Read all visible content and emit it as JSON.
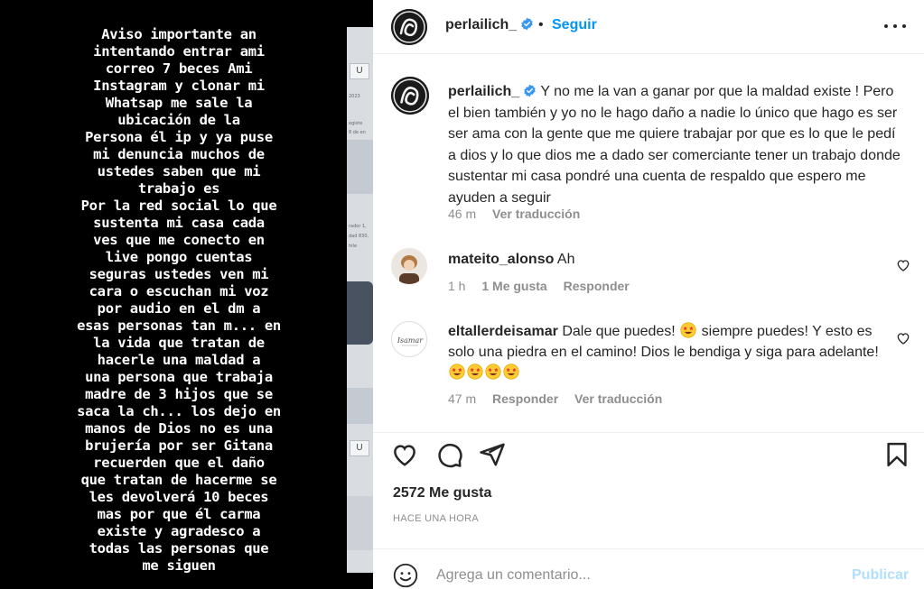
{
  "story": {
    "lines": [
      "Aviso importante  an",
      "intentando entrar ami",
      "correo 7 beces Ami",
      "Instagram  y clonar mi",
      "Whatsap me sale la",
      "ubicación de la",
      "Persona él ip  y ya puse",
      "mi denuncia muchos de",
      "ustedes saben que mi",
      "trabajo  es",
      "Por la red social lo que",
      "sustenta mi casa  cada",
      "ves que me conecto en",
      "live pongo  cuentas",
      "seguras ustedes ven mi",
      "cara o escuchan mi voz",
      "por audio  en el dm  a",
      "esas personas tan m... en",
      "la vida que tratan de",
      "hacerle una maldad a",
      "una persona que trabaja",
      "madre de 3 hijos que se",
      "saca la ch... los dejo en",
      "manos de Dios no es una",
      "brujería por ser Gitana",
      "recuerden que el daño",
      "que tratan de hacerme se",
      "les devolverá 10 beces",
      "mas  por que él carma",
      "existe  y agradesco a",
      "todas las personas que",
      "me siguen"
    ],
    "background_strip": {
      "tag_top": "U",
      "tag_bottom": "U",
      "tiny_lines": [
        "2023",
        "egiste",
        "8 de en",
        "rador 1,",
        "dad 830,",
        "hile"
      ]
    }
  },
  "header": {
    "username": "perlailich_",
    "separator": "•",
    "follow_label": "Seguir",
    "verified_icon": "verified-badge-icon",
    "more_icon": "more-options-icon"
  },
  "caption": {
    "username": "perlailich_",
    "text": "Y no me la van a ganar por que la maldad existe ! Pero el bien también y yo no le hago daño a nadie lo único que hago es ser ser ama con la gente que me quiere trabajar por que es lo que le pedí a dios y lo que dios me a dado ser comerciante tener un trabajo donde sustentar mi casa pondré una cuenta de respaldo que espero me ayuden a seguir",
    "time": "46 m",
    "translate_label": "Ver traducción"
  },
  "comments": [
    {
      "username": "mateito_alonso",
      "text": "Ah",
      "time": "1 h",
      "likes_label": "1 Me gusta",
      "reply_label": "Responder"
    },
    {
      "username": "eltallerdeisamar",
      "text_before": "Dale que puedes! ",
      "text_middle": " siempre puedes! Y esto es solo una piedra en el camino! Dios le bendiga y siga para adelante! ",
      "emoji": "star-struck-emoji",
      "trailing_emoji_count": 4,
      "time": "47 m",
      "reply_label": "Responder",
      "translate_label": "Ver traducción",
      "avatar_text": "Isamar"
    }
  ],
  "actions": {
    "like_icon": "heart-icon",
    "comment_icon": "comment-icon",
    "share_icon": "share-icon",
    "save_icon": "bookmark-icon",
    "likes_count": "2572 Me gusta",
    "timestamp": "HACE UNA HORA"
  },
  "add_comment": {
    "placeholder": "Agrega un comentario...",
    "publish_label": "Publicar",
    "emoji_icon": "emoji-smile-icon"
  },
  "colors": {
    "link_blue": "#0095f6",
    "publish_disabled": "#b2dffc",
    "muted_text": "#8e8e8e",
    "primary_text": "#262626",
    "story_background": "#000000"
  }
}
